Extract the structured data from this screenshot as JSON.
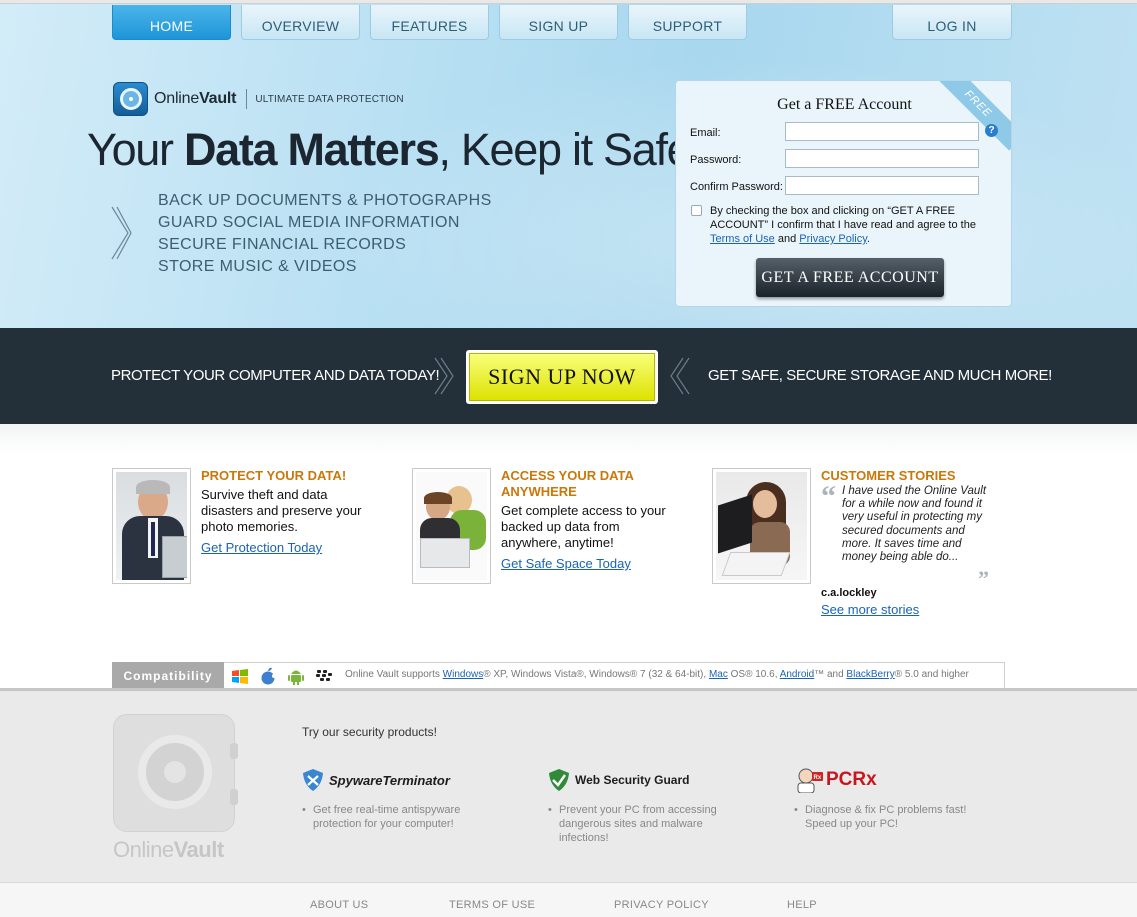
{
  "nav": {
    "home": "HOME",
    "overview": "OVERVIEW",
    "features": "FEATURES",
    "signup": "SIGN UP",
    "support": "SUPPORT",
    "login": "LOG IN"
  },
  "brand": {
    "name_light": "Online",
    "name_bold": "Vault",
    "tagline": "ULTIMATE DATA PROTECTION"
  },
  "hero": {
    "headline_1": "Your ",
    "headline_bold": "Data Matters",
    "headline_2": ", Keep it Safe",
    "bullets": [
      "BACK UP DOCUMENTS & PHOTOGRAPHS",
      "GUARD SOCIAL MEDIA INFORMATION",
      "SECURE FINANCIAL RECORDS",
      "STORE MUSIC & VIDEOS"
    ]
  },
  "form": {
    "ribbon": "FREE",
    "title": "Get a FREE Account",
    "email_label": "Email:",
    "password_label": "Password:",
    "confirm_label": "Confirm Password:",
    "help": "?",
    "terms_prefix": "By checking the box and clicking on “GET A FREE ACCOUNT” I confirm that I have read and agree to the ",
    "terms_link": "Terms of Use",
    "terms_and": " and ",
    "privacy_link": "Privacy Policy",
    "terms_suffix": ".",
    "submit": "GET A FREE ACCOUNT"
  },
  "band": {
    "left": "PROTECT YOUR COMPUTER AND DATA TODAY!",
    "button": "SIGN UP NOW",
    "right": "GET SAFE, SECURE STORAGE AND MUCH MORE!"
  },
  "features": [
    {
      "title": "PROTECT YOUR DATA!",
      "text": "Survive theft and data disasters and preserve your photo memories.",
      "link": "Get Protection Today"
    },
    {
      "title": "ACCESS YOUR DATA ANYWHERE",
      "text": "Get complete access to your backed up data from anywhere, anytime!",
      "link": "Get Safe Space Today"
    },
    {
      "title": "CUSTOMER STORIES",
      "quote": "I have used the Online Vault for a while now and found it very useful in protecting my secured documents and more. It saves time and money being able do...",
      "author": "c.a.lockley",
      "link": "See more stories"
    }
  ],
  "compat": {
    "label": "Compatibility",
    "os_icons": [
      "windows-icon",
      "apple-icon",
      "android-icon",
      "blackberry-icon"
    ],
    "t1": "Online Vault supports ",
    "windows": "Windows",
    "t2": "® XP, Windows Vista®, Windows® 7 (32 & 64-bit), ",
    "mac": "Mac",
    "t3": " OS® 10.6, ",
    "android": "Android",
    "t4": "™ and ",
    "blackberry": "BlackBerry",
    "t5": "® 5.0 and higher"
  },
  "footer": {
    "brand_light": "Online",
    "brand_bold": "Vault",
    "try": "Try our security products!",
    "products": [
      {
        "name": "SpywareTerminator",
        "desc": "Get free real-time antispyware protection for your computer!"
      },
      {
        "name": "Web Security Guard",
        "desc": "Prevent your PC from accessing dangerous sites and malware infections!"
      },
      {
        "name": "PCRx",
        "desc": "Diagnose & fix PC problems fast! Speed up your PC!"
      }
    ],
    "links": [
      "ABOUT US",
      "TERMS OF USE",
      "PRIVACY POLICY",
      "HELP"
    ]
  },
  "colors": {
    "accent_blue": "#1e95d8",
    "band_dark": "#23303a",
    "cta_yellow": "#e8ef1a",
    "feature_title": "#c9780a",
    "link": "#1a63b5"
  }
}
